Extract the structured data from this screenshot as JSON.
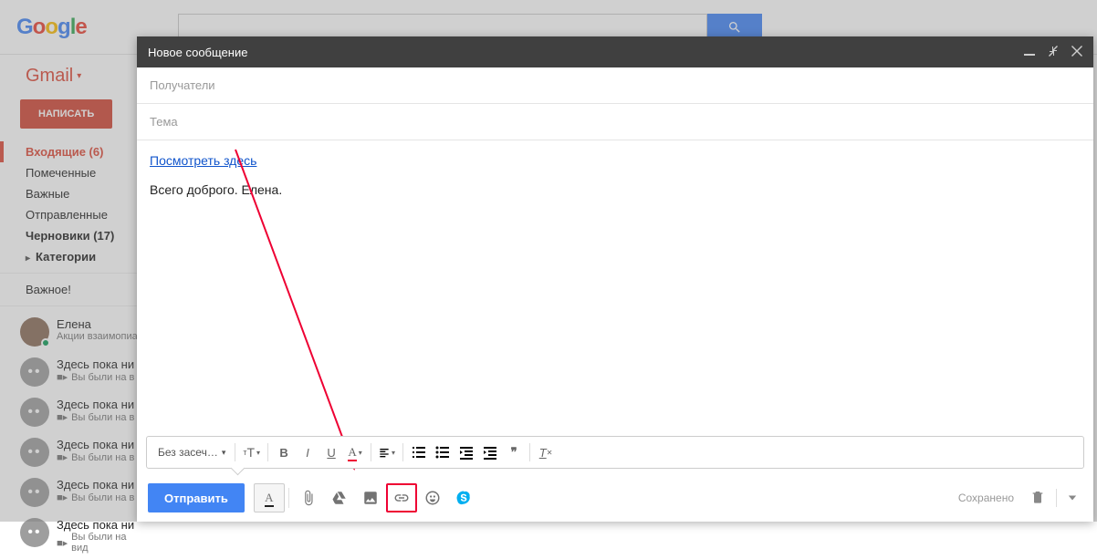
{
  "header": {
    "logo": "Google",
    "search_placeholder": ""
  },
  "gmail": {
    "label": "Gmail",
    "compose": "НАПИСАТЬ"
  },
  "nav": {
    "inbox": "Входящие (6)",
    "starred": "Помеченные",
    "important": "Важные",
    "sent": "Отправленные",
    "drafts": "Черновики (17)",
    "categories": "Категории",
    "importantSection": "Важное!"
  },
  "chats": [
    {
      "name": "Елена",
      "sub": "Акции взаимопиа",
      "color": true
    },
    {
      "name": "Здесь пока ни",
      "sub": "Вы были на в"
    },
    {
      "name": "Здесь пока ни",
      "sub": "Вы были на в"
    },
    {
      "name": "Здесь пока ни",
      "sub": "Вы были на в"
    },
    {
      "name": "Здесь пока ни",
      "sub": "Вы были на в"
    },
    {
      "name": "Здесь пока ни",
      "sub": "Вы были на вид"
    }
  ],
  "compose": {
    "title": "Новое сообщение",
    "to_placeholder": "Получатели",
    "subject_placeholder": "Тема",
    "body_link": "Посмотреть здесь",
    "body_text": "Всего доброго. Елена.",
    "font_label": "Без засеч…",
    "send": "Отправить",
    "saved": "Сохранено"
  }
}
